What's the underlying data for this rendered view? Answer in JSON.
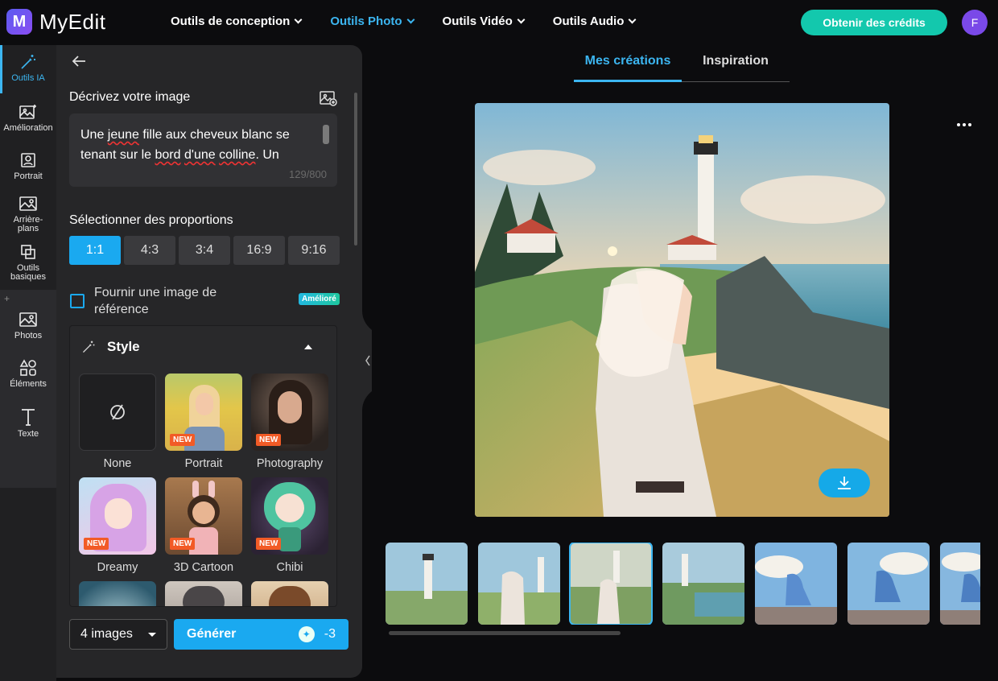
{
  "app": {
    "name": "MyEdit",
    "logo_letter": "M"
  },
  "nav": [
    {
      "label": "Outils de conception",
      "active": false
    },
    {
      "label": "Outils Photo",
      "active": true
    },
    {
      "label": "Outils Vidéo",
      "active": false
    },
    {
      "label": "Outils Audio",
      "active": false
    }
  ],
  "header": {
    "credits_button": "Obtenir des crédits",
    "avatar_initial": "F"
  },
  "rail": [
    {
      "label": "Outils IA",
      "icon": "magic-wand-icon",
      "active": true
    },
    {
      "label": "Amélioration",
      "icon": "image-sparkle-icon"
    },
    {
      "label": "Portrait",
      "icon": "portrait-icon"
    },
    {
      "label": "Arrière-plans",
      "icon": "background-icon"
    },
    {
      "label": "Outils basiques",
      "icon": "crop-icon"
    },
    {
      "label": "Photos",
      "icon": "photo-icon"
    },
    {
      "label": "Éléments",
      "icon": "shapes-icon"
    },
    {
      "label": "Texte",
      "icon": "text-icon"
    }
  ],
  "panel": {
    "describe_label": "Décrivez votre image",
    "prompt_text": "Une jeune fille aux cheveux blanc se tenant sur le bord d'une colline. Un",
    "prompt_part1": "Une ",
    "prompt_w1": "jeune",
    "prompt_part2": " fille aux cheveux blanc se tenant sur le ",
    "prompt_w2": "bord",
    "prompt_part3": " ",
    "prompt_w3": "d'une",
    "prompt_part4": " ",
    "prompt_w4": "colline",
    "prompt_part5": ". Un",
    "char_count": "129/800",
    "ratio_label": "Sélectionner des proportions",
    "ratios": [
      "1:1",
      "4:3",
      "3:4",
      "16:9",
      "9:16"
    ],
    "selected_ratio": "1:1",
    "reference_label": "Fournir une image de référence",
    "reference_badge": "Amélioré",
    "style_title": "Style",
    "styles": [
      {
        "name": "None",
        "new": false
      },
      {
        "name": "Portrait",
        "new": true
      },
      {
        "name": "Photography",
        "new": true
      },
      {
        "name": "Dreamy",
        "new": true
      },
      {
        "name": "3D Cartoon",
        "new": true
      },
      {
        "name": "Chibi",
        "new": true
      }
    ],
    "new_badge": "NEW",
    "image_count": "4 images",
    "generate_label": "Générer",
    "generate_cost": "-3"
  },
  "main": {
    "tabs": [
      {
        "label": "Mes créations",
        "active": true
      },
      {
        "label": "Inspiration",
        "active": false
      }
    ],
    "thumbnail_count": 7,
    "selected_thumbnail": 3
  },
  "colors": {
    "accent": "#1aa9f0",
    "credits": "#13c8ad",
    "avatar": "#7a49e8",
    "new_badge": "#f25b26"
  }
}
